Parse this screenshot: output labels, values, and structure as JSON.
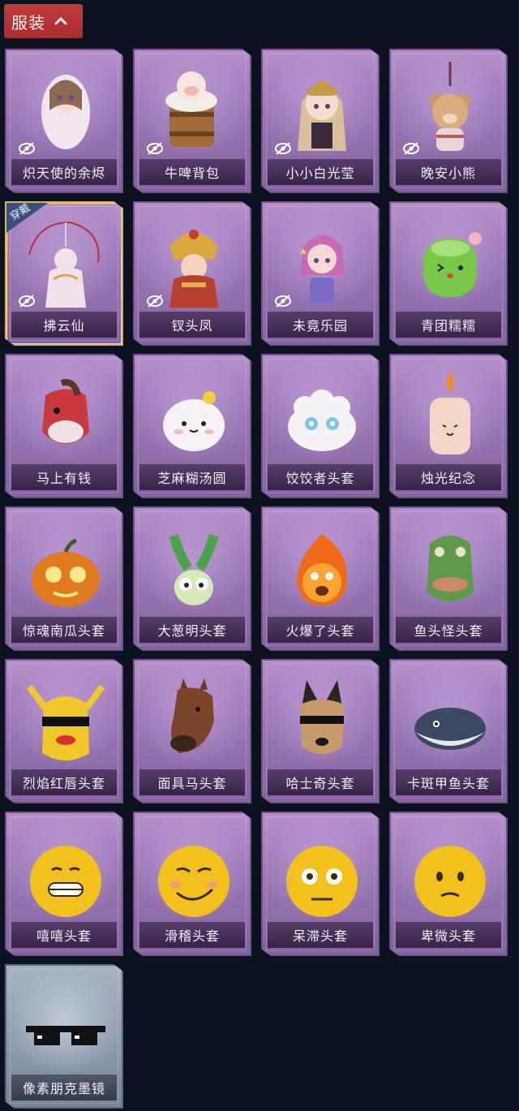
{
  "header": {
    "title": "服装"
  },
  "badge": {
    "wearing": "穿戴"
  },
  "items": [
    {
      "label": "炽天使的余烬",
      "hidden": true
    },
    {
      "label": "牛啤背包",
      "hidden": true
    },
    {
      "label": "小小白光莹",
      "hidden": true
    },
    {
      "label": "晚安小熊",
      "hidden": true
    },
    {
      "label": "拂云仙",
      "hidden": true,
      "wearing": true
    },
    {
      "label": "钗头凤",
      "hidden": true
    },
    {
      "label": "未竟乐园",
      "hidden": true
    },
    {
      "label": "青团糯糯"
    },
    {
      "label": "马上有钱"
    },
    {
      "label": "芝麻糊汤圆"
    },
    {
      "label": "饺饺者头套"
    },
    {
      "label": "烛光纪念"
    },
    {
      "label": "惊魂南瓜头套"
    },
    {
      "label": "大葱明头套"
    },
    {
      "label": "火爆了头套"
    },
    {
      "label": "鱼头怪头套"
    },
    {
      "label": "烈焰红唇头套"
    },
    {
      "label": "面具马头套"
    },
    {
      "label": "哈士奇头套"
    },
    {
      "label": "卡斑甲鱼头套"
    },
    {
      "label": "嘻嘻头套"
    },
    {
      "label": "滑稽头套"
    },
    {
      "label": "呆滞头套"
    },
    {
      "label": "卑微头套"
    },
    {
      "label": "像素朋克墨镜",
      "rarity": "grey"
    }
  ]
}
